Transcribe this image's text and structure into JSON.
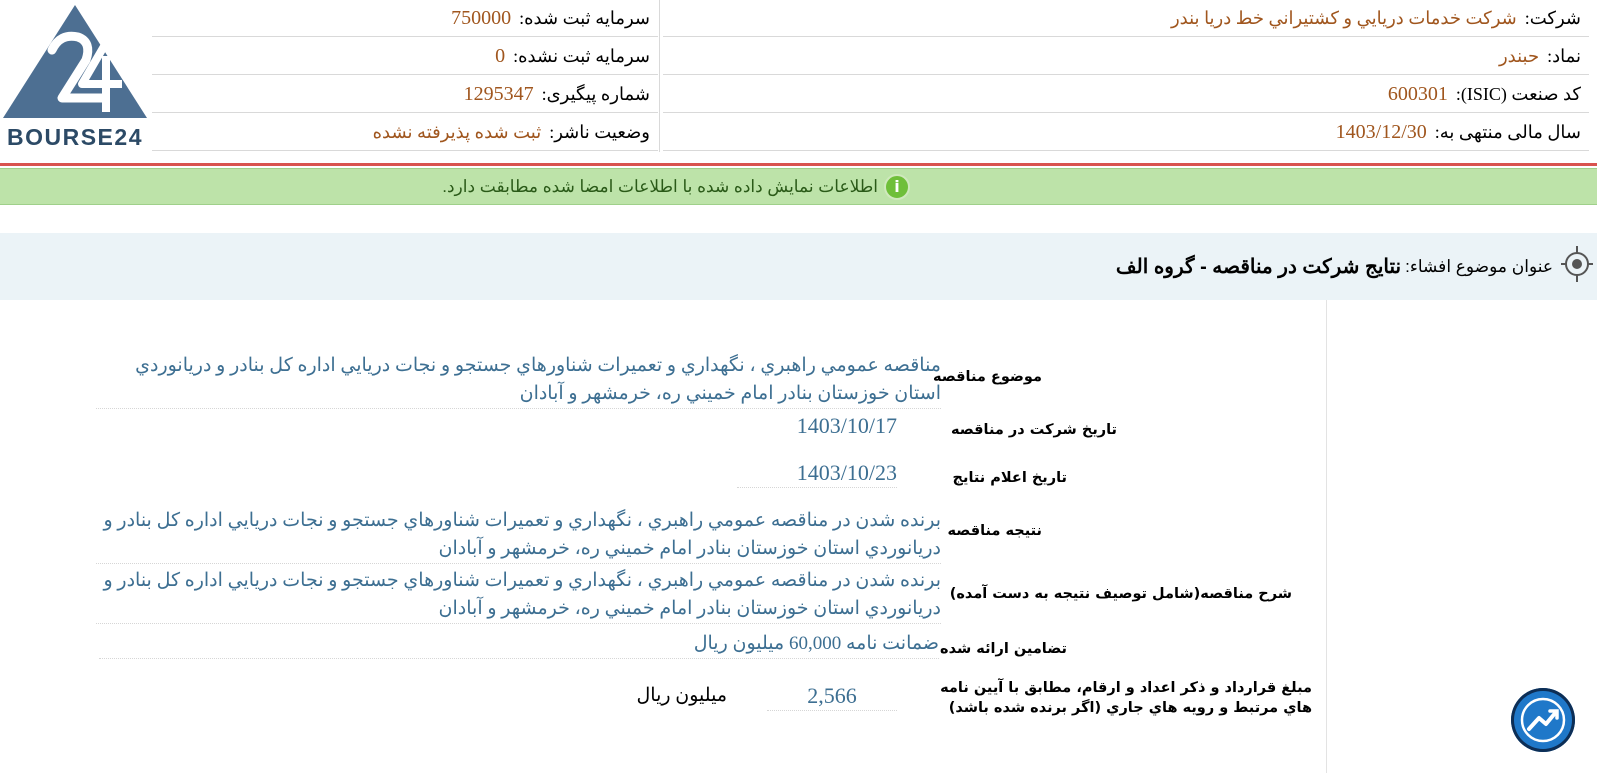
{
  "brand": {
    "logo_text": "BOURSE24",
    "logo_mark": "24"
  },
  "header": {
    "company": {
      "label": "شرکت:",
      "value": "شرکت خدمات دريايي و کشتيراني خط دريا بندر"
    },
    "symbol": {
      "label": "نماد:",
      "value": "حبندر"
    },
    "isic": {
      "label": "کد صنعت (ISIC):",
      "value": "600301"
    },
    "fiscal_year": {
      "label": "سال مالی منتهی به:",
      "value": "1403/12/30"
    },
    "registered_capital": {
      "label": "سرمایه ثبت شده:",
      "value": "750000"
    },
    "unregistered_capital": {
      "label": "سرمایه ثبت نشده:",
      "value": "0"
    },
    "tracking_number": {
      "label": "شماره پیگیری:",
      "value": "1295347"
    },
    "publisher_status": {
      "label": "وضعیت ناشر:",
      "value": "ثبت شده پذیرفته نشده"
    }
  },
  "notice": {
    "icon": "info-icon",
    "message": "اطلاعات نمایش داده شده با اطلاعات امضا شده مطابقت دارد."
  },
  "disclosure": {
    "title_label": "عنوان موضوع افشاء:",
    "title_value": "نتایج شرکت در مناقصه - گروه الف"
  },
  "details": [
    {
      "label": "موضوع مناقصه",
      "value": "مناقصه عمومي راهبري ، نگهداري و تعميرات شناورهاي جستجو و نجات دريايي اداره کل بنادر و دريانوردي استان خوزستان بنادر امام خميني ره، خرمشهر و آبادان"
    },
    {
      "label": "تاريخ شرکت در مناقصه",
      "value": "1403/10/17"
    },
    {
      "label": "تاريخ اعلام نتايج",
      "value": "1403/10/23"
    },
    {
      "label": "نتيجه مناقصه",
      "value": "برنده شدن در مناقصه عمومي راهبري ، نگهداري و تعميرات شناورهاي جستجو و نجات دريايي اداره کل بنادر و دريانوردي استان خوزستان بنادر امام خميني ره، خرمشهر و آبادان"
    },
    {
      "label": "شرح مناقصه(شامل توصيف نتيجه به دست آمده)",
      "value": "برنده شدن در مناقصه عمومي راهبري ، نگهداري و تعميرات شناورهاي جستجو و نجات دريايي اداره کل بنادر و دريانوردي استان خوزستان بنادر امام خميني ره، خرمشهر و آبادان"
    },
    {
      "label": "تضامين ارائه شده",
      "value": "ضمانت نامه 60,000 ميليون ريال"
    },
    {
      "label": "مبلغ قرارداد و ذکر اعداد و ارقام، مطابق با آيين نامه هاي مرتبط و رويه هاي جاري (اگر برنده شده باشد)",
      "value": "2,566",
      "unit": "ميليون ريال"
    }
  ]
}
